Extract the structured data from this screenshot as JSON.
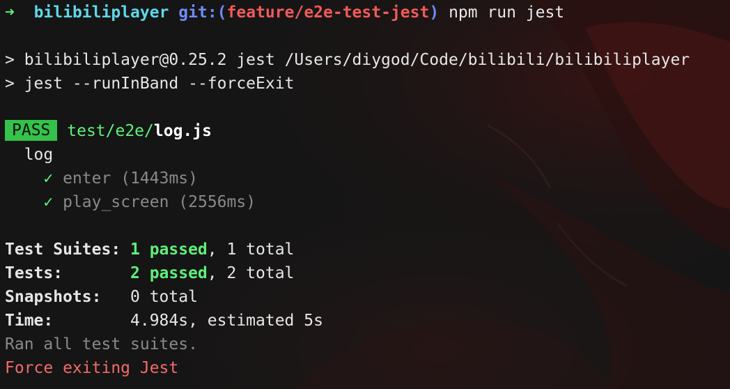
{
  "prompt": {
    "arrow": "➜",
    "directory": "bilibiliplayer",
    "git_prefix": "git:(",
    "branch": "feature/e2e-test-jest",
    "git_suffix": ")",
    "command": "npm run jest"
  },
  "script_lines": [
    "> bilibiliplayer@0.25.2 jest /Users/diygod/Code/bilibili/bilibiliplayer",
    "> jest --runInBand --forceExit"
  ],
  "result": {
    "badge": "PASS",
    "path_dir": "test/e2e/",
    "path_file": "log.js",
    "suite_name": "log",
    "tests": [
      {
        "check": "✓",
        "name": "enter",
        "duration": "(1443ms)"
      },
      {
        "check": "✓",
        "name": "play_screen",
        "duration": "(2556ms)"
      }
    ]
  },
  "summary": {
    "suites_label": "Test Suites:",
    "suites_passed": "1 passed",
    "suites_total": ", 1 total",
    "tests_label": "Tests:",
    "tests_passed": "2 passed",
    "tests_total": ", 2 total",
    "snapshots_label": "Snapshots:",
    "snapshots_value": "0 total",
    "time_label": "Time:",
    "time_value": "4.984s, estimated 5s",
    "ran_all": "Ran all test suites.",
    "force_exit": "Force exiting Jest"
  }
}
